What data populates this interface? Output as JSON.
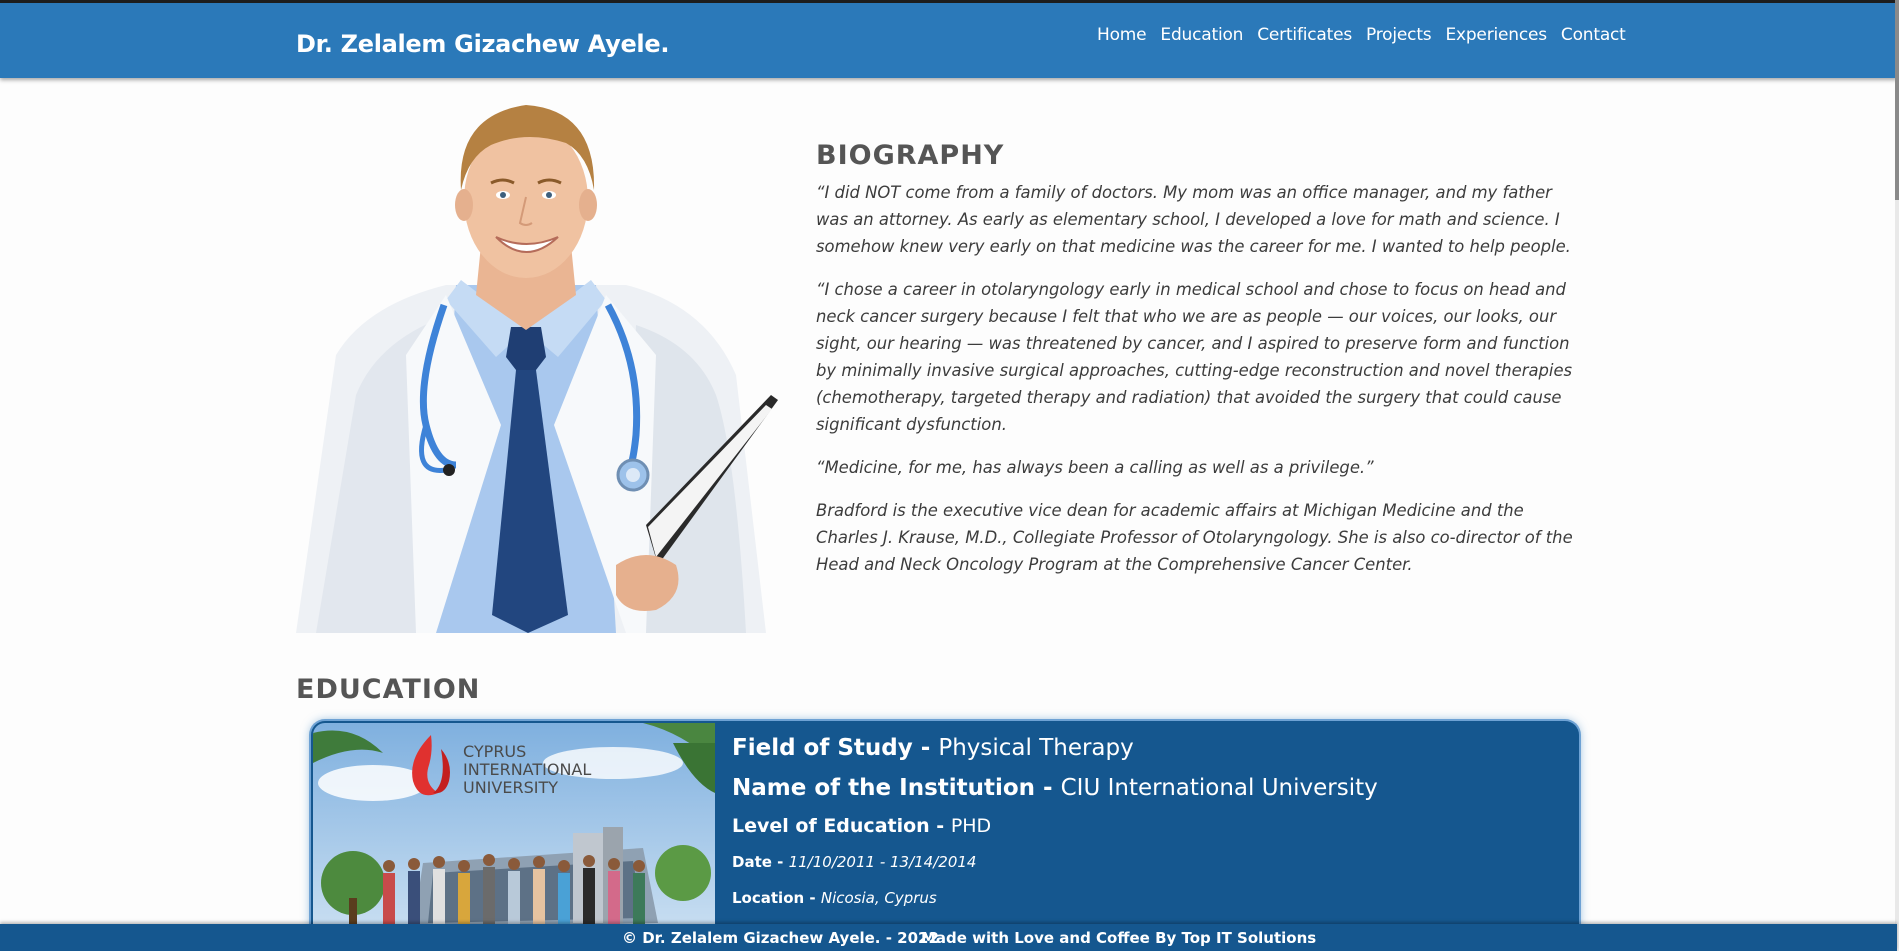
{
  "header": {
    "brand": "Dr. Zelalem Gizachew Ayele.",
    "nav": [
      "Home",
      "Education",
      "Certificates",
      "Projects",
      "Experiences",
      "Contact"
    ]
  },
  "biography": {
    "title": "BIOGRAPHY",
    "paragraphs": [
      "“I did NOT come from a family of doctors. My mom was an office manager, and my father was an attorney. As early as elementary school, I developed a love for math and science. I somehow knew very early on that medicine was the career for me. I wanted to help people.",
      "“I chose a career in otolaryngology early in medical school and chose to focus on head and neck cancer surgery because I felt that who we are as people — our voices, our looks, our sight, our hearing — was threatened by cancer, and I aspired to preserve form and function by minimally invasive surgical approaches, cutting-edge reconstruction and novel therapies (chemotherapy, targeted therapy and radiation) that avoided the surgery that could cause significant dysfunction.",
      "“Medicine, for me, has always been a calling as well as a privilege.”",
      "Bradford is the executive vice dean for academic affairs at Michigan Medicine and the Charles J. Krause, M.D., Collegiate Professor of Otolaryngology. She is also co-director of the Head and Neck Oncology Program at the Comprehensive Cancer Center."
    ]
  },
  "education": {
    "title": "EDUCATION",
    "card": {
      "logo_line1": "CYPRUS",
      "logo_line2": "INTERNATIONAL",
      "logo_line3": "UNIVERSITY",
      "field_label": "Field of Study - ",
      "field_value": "Physical Therapy",
      "institution_label": "Name of the Institution - ",
      "institution_value": "CIU International University",
      "level_label": "Level of Education - ",
      "level_value": "PHD",
      "date_label": "Date - ",
      "date_value": "11/10/2011 - 13/14/2014",
      "location_label": "Location - ",
      "location_value": "Nicosia, Cyprus"
    }
  },
  "footer": {
    "copyright": "© Dr. Zelalem Gizachew Ayele. - 2022",
    "made_with": "Made with Love and Coffee By Top IT Solutions"
  },
  "colors": {
    "header_bg": "#2b79b9",
    "card_bg": "#15578f",
    "footer_bg": "#15578f",
    "heading_text": "#555555"
  }
}
